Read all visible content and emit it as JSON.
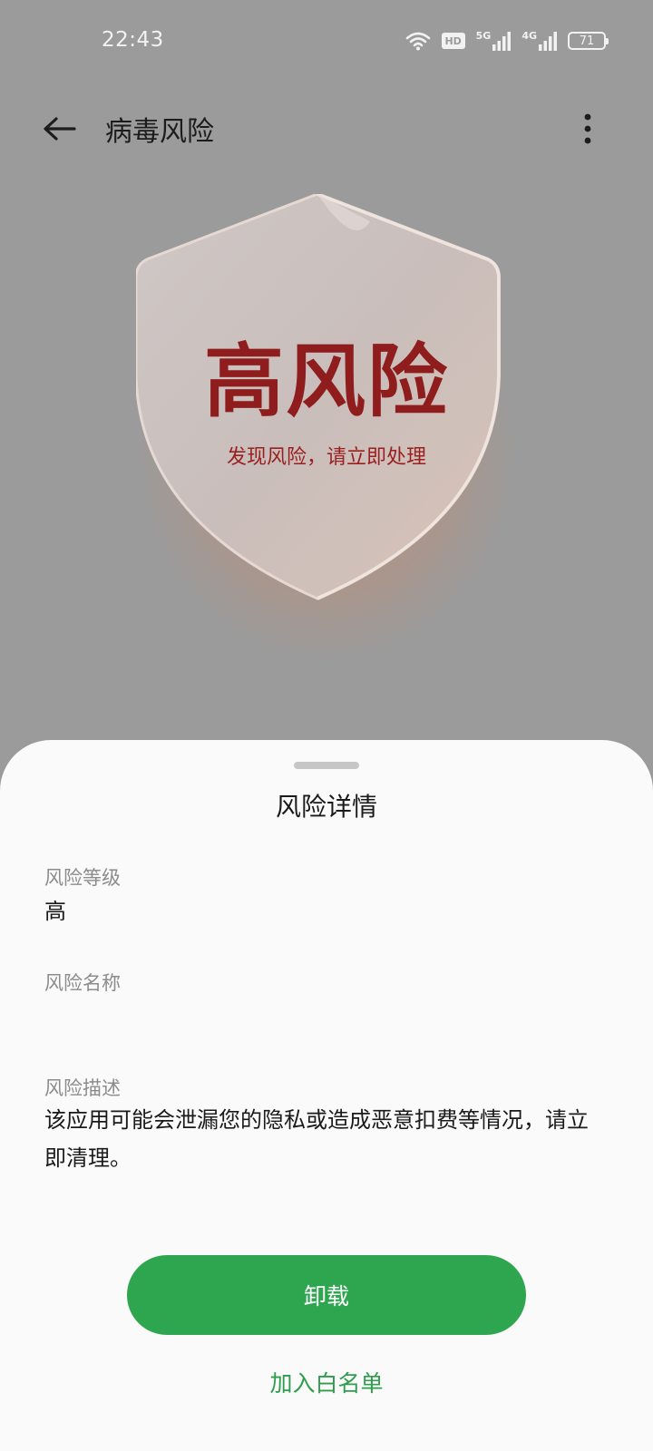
{
  "status_bar": {
    "time": "22:43",
    "wifi_icon": "wifi-icon",
    "hd_label": "HD",
    "network_5g_label": "5G",
    "network_4g_label": "4G",
    "battery_level": "71"
  },
  "app_bar": {
    "title": "病毒风险",
    "back_icon": "arrow-left-icon",
    "more_icon": "more-vertical-icon"
  },
  "hero": {
    "level_title": "高风险",
    "subtitle": "发现风险，请立即处理",
    "shield_icon": "shield-icon",
    "accent_color": "#8f1d1d"
  },
  "sheet": {
    "title": "风险详情",
    "fields": [
      {
        "label": "风险等级",
        "value": "高"
      },
      {
        "label": "风险名称",
        "value": ""
      },
      {
        "label": "风险描述",
        "value": "该应用可能会泄漏您的隐私或造成恶意扣费等情况，请立即清理。"
      }
    ],
    "primary_button_label": "卸载",
    "secondary_link_label": "加入白名单",
    "primary_color": "#2ea64f"
  }
}
